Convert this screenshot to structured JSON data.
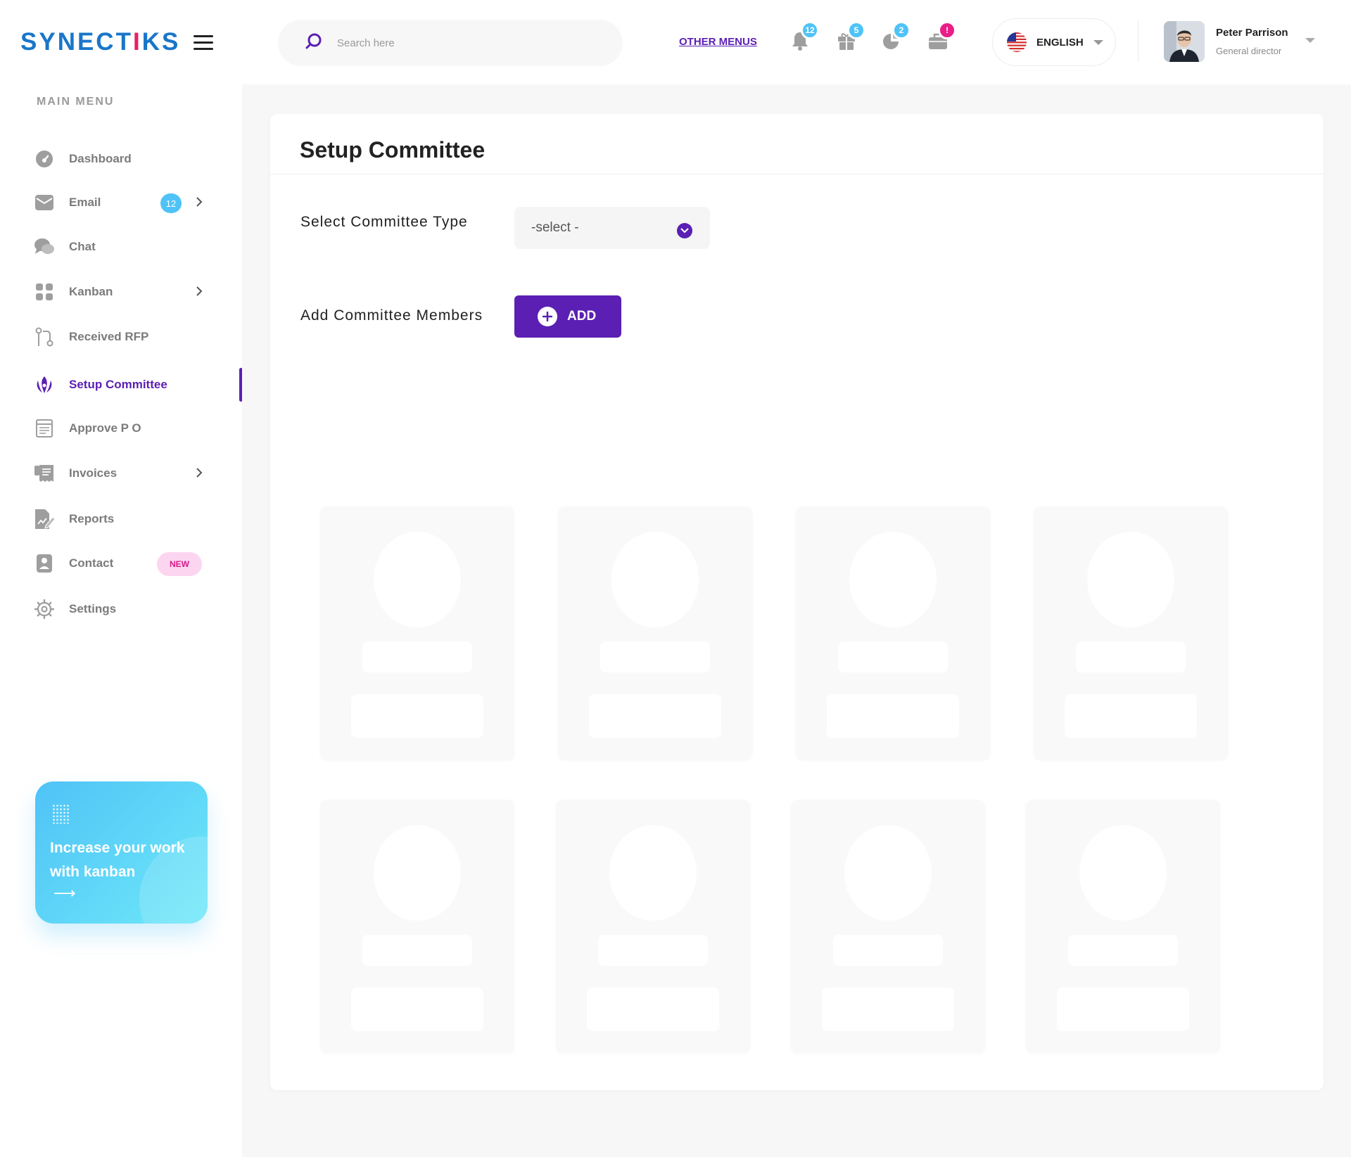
{
  "brand": {
    "logo_pre": "SYNECT",
    "logo_i": "I",
    "logo_post": "KS"
  },
  "sidebar": {
    "menu_title": "MAIN MENU",
    "items": [
      {
        "label": "Dashboard",
        "icon": "gauge-icon"
      },
      {
        "label": "Email",
        "icon": "mail-icon",
        "badge": "12"
      },
      {
        "label": "Chat",
        "icon": "chat-icon"
      },
      {
        "label": "Kanban",
        "icon": "grid-icon"
      },
      {
        "label": "Received RFP",
        "icon": "git-pull-icon"
      },
      {
        "label": "Setup Committee",
        "icon": "committee-icon",
        "active": true
      },
      {
        "label": "Approve P O",
        "icon": "document-icon"
      },
      {
        "label": "Invoices",
        "icon": "invoice-icon"
      },
      {
        "label": "Reports",
        "icon": "report-icon"
      },
      {
        "label": "Contact",
        "icon": "contact-icon",
        "badge": "NEW"
      },
      {
        "label": "Settings",
        "icon": "gear-icon"
      }
    ],
    "promo": {
      "text": "Increase your work with kanban",
      "arrow": "⟶"
    }
  },
  "header": {
    "search_placeholder": "Search here",
    "other_menus": "OTHER MENUS",
    "notifications": [
      {
        "icon": "bell-icon",
        "badge": "12"
      },
      {
        "icon": "gift-icon",
        "badge": "5"
      },
      {
        "icon": "chart-icon",
        "badge": "2"
      },
      {
        "icon": "briefcase-icon",
        "badge": "!"
      }
    ],
    "language": "ENGLISH",
    "user": {
      "name": "Peter Parrison",
      "role": "General director"
    }
  },
  "page": {
    "title": "Setup Committee",
    "committee_type_label": "Select Committee Type",
    "committee_type_value": "-select -",
    "add_members_label": "Add Committee Members",
    "add_button": "ADD"
  },
  "colors": {
    "accent": "#5b1fb3",
    "badge_blue": "#4fc3f7",
    "badge_pink": "#e91e88",
    "logo_blue": "#1976c9"
  }
}
